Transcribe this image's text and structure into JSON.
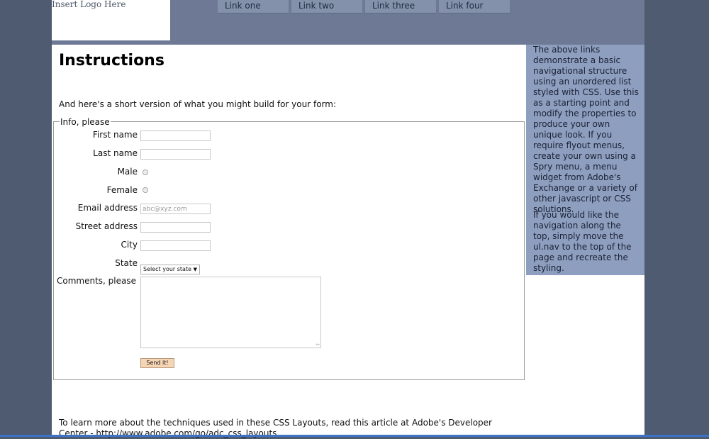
{
  "header": {
    "logo_text": "Insert Logo Here",
    "nav": [
      {
        "label": "Link one"
      },
      {
        "label": "Link two"
      },
      {
        "label": "Link three"
      },
      {
        "label": "Link four"
      }
    ]
  },
  "content": {
    "title": "Instructions",
    "intro": "And here's a short version of what you might build for your form:",
    "form": {
      "legend": "Info, please",
      "first_name_label": "First name",
      "last_name_label": "Last name",
      "male_label": "Male",
      "female_label": "Female",
      "email_label": "Email address",
      "email_placeholder": "abc@xyz.com",
      "street_label": "Street address",
      "city_label": "City",
      "state_label": "State",
      "state_selected": "Select your state",
      "comments_label": "Comments, please",
      "send_label": "Send it!"
    },
    "footer": "To learn more about the techniques used in these CSS Layouts, read this article at Adobe's Developer Center - http://www.adobe.com/go/adc_css_layouts"
  },
  "sidebar": {
    "paragraphs": [
      "The above links demonstrate a basic navigational structure using an unordered list styled with CSS. Use this as a starting point and modify the properties to produce your own unique look. If you require flyout menus, create your own using a Spry menu, a menu widget from Adobe's Exchange or a variety of other javascript or CSS solutions.",
      "If you would like the navigation along the top, simply move the ul.nav to the top of the page and recreate the styling."
    ]
  }
}
